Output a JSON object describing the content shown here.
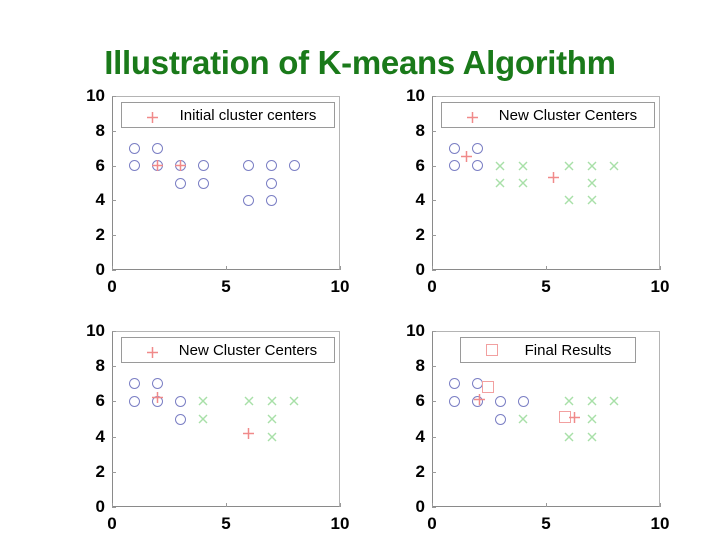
{
  "slide": {
    "title": "Illustration of K-means Algorithm",
    "title_color": "#1a7a1a",
    "background": "#ffffff"
  },
  "colors": {
    "circle": "#7b7fc4",
    "cross": "#a8e0a8",
    "plus": "#f08a8a",
    "square": "#f2a0a0",
    "axis": "#8a8a8a",
    "tick_text": "#000000"
  },
  "chart_data": [
    {
      "id": "chart-top-left",
      "type": "scatter",
      "title": "",
      "xlabel": "",
      "ylabel": "",
      "xlim": [
        0,
        10
      ],
      "ylim": [
        0,
        10
      ],
      "xticks": [
        "0",
        "5",
        "10"
      ],
      "xtick_values": [
        0,
        5,
        10
      ],
      "yticks": [
        "0",
        "2",
        "4",
        "6",
        "8",
        "10"
      ],
      "ytick_values": [
        0,
        2,
        4,
        6,
        8,
        10
      ],
      "grid": false,
      "legend": {
        "position": "upper-center",
        "label": "Initial cluster centers",
        "marker": "plus-marker"
      },
      "series": [
        {
          "name": "data-points",
          "marker": "circle-marker",
          "color": "#7b7fc4",
          "points": [
            [
              1,
              7
            ],
            [
              2,
              7
            ],
            [
              1,
              6
            ],
            [
              2,
              6
            ],
            [
              3,
              6
            ],
            [
              4,
              6
            ],
            [
              3,
              5
            ],
            [
              4,
              5
            ],
            [
              6,
              6
            ],
            [
              7,
              6
            ],
            [
              8,
              6
            ],
            [
              7,
              5
            ],
            [
              6,
              4
            ],
            [
              7,
              4
            ]
          ]
        },
        {
          "name": "cluster-centers",
          "marker": "plus-marker",
          "color": "#f08a8a",
          "points": [
            [
              2,
              6
            ],
            [
              3,
              6
            ]
          ]
        }
      ]
    },
    {
      "id": "chart-top-right",
      "type": "scatter",
      "title": "",
      "xlabel": "",
      "ylabel": "",
      "xlim": [
        0,
        10
      ],
      "ylim": [
        0,
        10
      ],
      "xticks": [
        "0",
        "5",
        "10"
      ],
      "xtick_values": [
        0,
        5,
        10
      ],
      "yticks": [
        "0",
        "2",
        "4",
        "6",
        "8",
        "10"
      ],
      "ytick_values": [
        0,
        2,
        4,
        6,
        8,
        10
      ],
      "grid": false,
      "legend": {
        "position": "upper-center",
        "label": "New Cluster Centers",
        "marker": "plus-marker"
      },
      "series": [
        {
          "name": "cluster-a-points",
          "marker": "circle-marker",
          "color": "#7b7fc4",
          "points": [
            [
              1,
              7
            ],
            [
              2,
              7
            ],
            [
              1,
              6
            ],
            [
              2,
              6
            ]
          ]
        },
        {
          "name": "cluster-b-points",
          "marker": "cross-marker",
          "color": "#a8e0a8",
          "points": [
            [
              3,
              6
            ],
            [
              4,
              6
            ],
            [
              3,
              5
            ],
            [
              4,
              5
            ],
            [
              6,
              6
            ],
            [
              7,
              6
            ],
            [
              8,
              6
            ],
            [
              7,
              5
            ],
            [
              6,
              4
            ],
            [
              7,
              4
            ]
          ]
        },
        {
          "name": "cluster-centers",
          "marker": "plus-marker",
          "color": "#f08a8a",
          "points": [
            [
              1.5,
              6.5
            ],
            [
              5.35,
              5.3
            ]
          ]
        }
      ]
    },
    {
      "id": "chart-bottom-left",
      "type": "scatter",
      "title": "",
      "xlabel": "",
      "ylabel": "",
      "xlim": [
        0,
        10
      ],
      "ylim": [
        0,
        10
      ],
      "xticks": [
        "0",
        "5",
        "10"
      ],
      "xtick_values": [
        0,
        5,
        10
      ],
      "yticks": [
        "0",
        "2",
        "4",
        "6",
        "8",
        "10"
      ],
      "ytick_values": [
        0,
        2,
        4,
        6,
        8,
        10
      ],
      "grid": false,
      "legend": {
        "position": "upper-center",
        "label": "New Cluster Centers",
        "marker": "plus-marker"
      },
      "series": [
        {
          "name": "cluster-a-points",
          "marker": "circle-marker",
          "color": "#7b7fc4",
          "points": [
            [
              1,
              7
            ],
            [
              2,
              7
            ],
            [
              1,
              6
            ],
            [
              2,
              6
            ],
            [
              3,
              6
            ],
            [
              3,
              5
            ]
          ]
        },
        {
          "name": "cluster-b-points",
          "marker": "cross-marker",
          "color": "#a8e0a8",
          "points": [
            [
              4,
              6
            ],
            [
              4,
              5
            ],
            [
              6,
              6
            ],
            [
              7,
              6
            ],
            [
              8,
              6
            ],
            [
              7,
              5
            ],
            [
              7,
              4
            ]
          ]
        },
        {
          "name": "cluster-centers",
          "marker": "plus-marker",
          "color": "#f08a8a",
          "points": [
            [
              2,
              6.2
            ],
            [
              6,
              4.2
            ]
          ]
        }
      ]
    },
    {
      "id": "chart-bottom-right",
      "type": "scatter",
      "title": "",
      "xlabel": "",
      "ylabel": "",
      "xlim": [
        0,
        10
      ],
      "ylim": [
        0,
        10
      ],
      "xticks": [
        "0",
        "5",
        "10"
      ],
      "xtick_values": [
        0,
        5,
        10
      ],
      "yticks": [
        "0",
        "2",
        "4",
        "6",
        "8",
        "10"
      ],
      "ytick_values": [
        0,
        2,
        4,
        6,
        8,
        10
      ],
      "grid": false,
      "legend": {
        "position": "upper-center",
        "label": "Final Results",
        "marker": "square-marker"
      },
      "series": [
        {
          "name": "cluster-a-points",
          "marker": "circle-marker",
          "color": "#7b7fc4",
          "points": [
            [
              1,
              7
            ],
            [
              2,
              7
            ],
            [
              1,
              6
            ],
            [
              2,
              6
            ],
            [
              3,
              6
            ],
            [
              4,
              6
            ],
            [
              3,
              5
            ]
          ]
        },
        {
          "name": "cluster-b-points",
          "marker": "cross-marker",
          "color": "#a8e0a8",
          "points": [
            [
              4,
              5
            ],
            [
              6,
              6
            ],
            [
              7,
              6
            ],
            [
              8,
              6
            ],
            [
              7,
              5
            ],
            [
              6,
              4
            ],
            [
              7,
              4
            ]
          ]
        },
        {
          "name": "final-centers",
          "marker": "square-marker",
          "color": "#f2a0a0",
          "points": [
            [
              2.45,
              6.8
            ],
            [
              5.85,
              5.1
            ]
          ]
        },
        {
          "name": "cluster-centers",
          "marker": "plus-marker",
          "color": "#f08a8a",
          "points": [
            [
              2.1,
              6.1
            ],
            [
              6.25,
              5.1
            ]
          ]
        }
      ]
    }
  ]
}
